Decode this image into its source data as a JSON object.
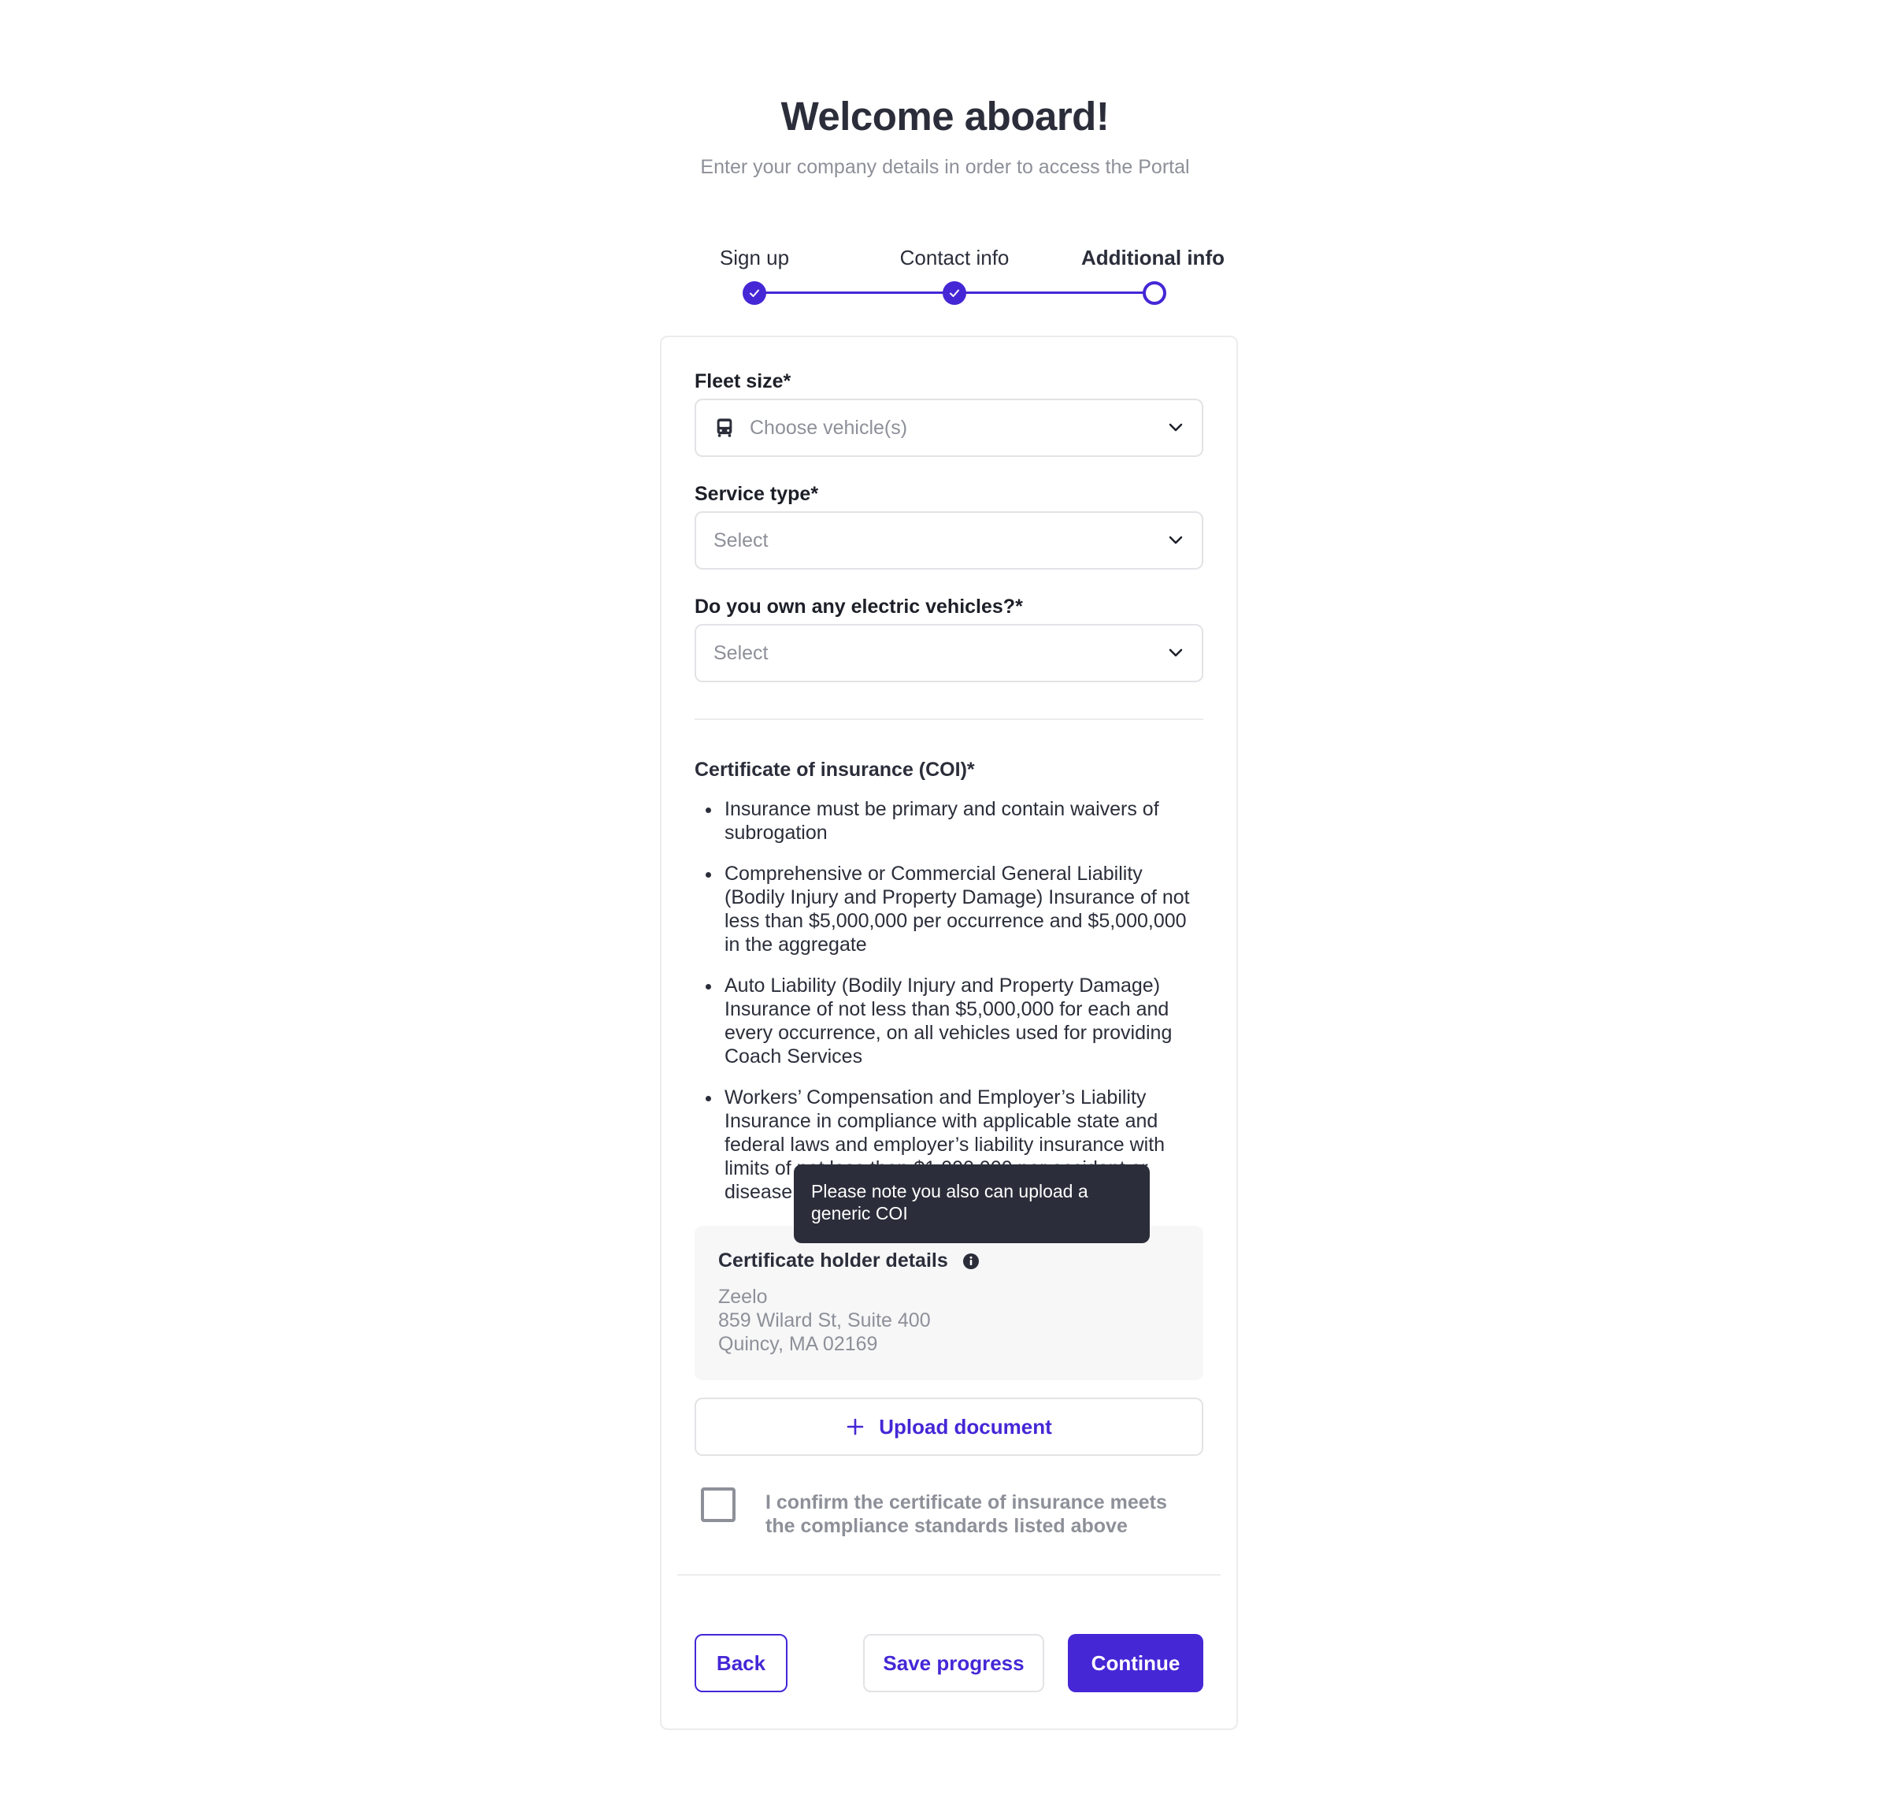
{
  "header": {
    "title": "Welcome aboard!",
    "subtitle": "Enter your company details in order to access the Portal"
  },
  "stepper": {
    "steps": [
      {
        "label": "Sign up",
        "state": "complete"
      },
      {
        "label": "Contact info",
        "state": "complete"
      },
      {
        "label": "Additional info",
        "state": "current"
      }
    ]
  },
  "form": {
    "fleet_size": {
      "label": "Fleet size*",
      "placeholder": "Choose vehicle(s)",
      "icon": "bus-icon"
    },
    "service_type": {
      "label": "Service type*",
      "placeholder": "Select"
    },
    "electric": {
      "label": "Do you own any electric vehicles?*",
      "placeholder": "Select"
    }
  },
  "coi": {
    "title": "Certificate of insurance (COI)*",
    "items": [
      "Insurance must be primary and contain waivers of subrogation",
      "Comprehensive or Commercial General Liability (Bodily Injury and Property Damage) Insurance of not less than $5,000,000 per occurrence and $5,000,000 in the aggregate",
      "Auto Liability (Bodily Injury and Property Damage) Insurance of not less than $5,000,000 for each and every occurrence, on all vehicles used for providing Coach Services",
      "Workers’ Compensation and Employer’s Liability Insurance in compliance with applicable state and federal laws and employer’s liability insurance with limits of not less than $1,000,000 per accident or disease"
    ],
    "tooltip": "Please note you also can upload a generic COI",
    "holder": {
      "title": "Certificate holder details",
      "lines": [
        "Zeelo",
        "859 Wilard St, Suite 400",
        "Quincy, MA 02169"
      ]
    },
    "upload_label": "Upload document",
    "confirm_text": "I confirm the certificate of insurance meets the compliance standards listed above"
  },
  "actions": {
    "back": "Back",
    "save": "Save progress",
    "continue": "Continue"
  },
  "colors": {
    "accent": "#4527d6",
    "text": "#2b2e3a",
    "muted": "#8e9099",
    "tooltip_bg": "#2b2e3a"
  }
}
